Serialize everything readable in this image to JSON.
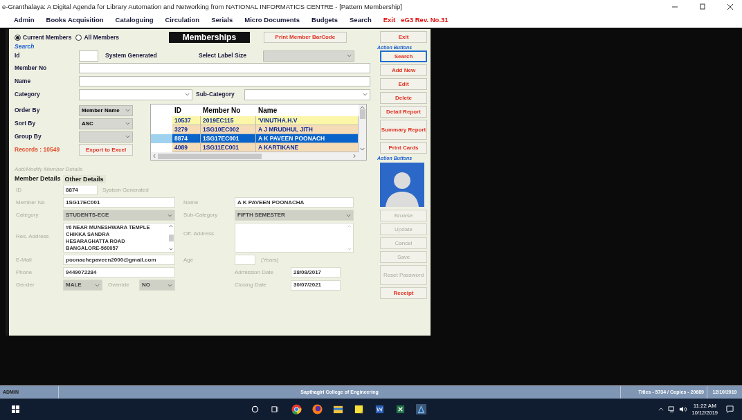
{
  "window": {
    "title": "e-Granthalaya: A Digital Agenda for Library Automation and Networking from NATIONAL INFORMATICS CENTRE - [Pattern Membership]"
  },
  "menu": [
    {
      "label": "Admin",
      "kind": "item"
    },
    {
      "label": "Books Acquisition",
      "kind": "item"
    },
    {
      "label": "Cataloguing",
      "kind": "item"
    },
    {
      "label": "Circulation",
      "kind": "item"
    },
    {
      "label": "Serials",
      "kind": "item"
    },
    {
      "label": "Micro Documents",
      "kind": "item"
    },
    {
      "label": "Budgets",
      "kind": "item"
    },
    {
      "label": "Search",
      "kind": "item"
    },
    {
      "label": "Exit",
      "kind": "exit"
    },
    {
      "label": "eG3 Rev. No.31",
      "kind": "version"
    }
  ],
  "form": {
    "filters": [
      {
        "label": "Current Members",
        "selected": true
      },
      {
        "label": "All Members",
        "selected": false
      }
    ],
    "heading": "Memberships",
    "print_barcode_button": "Print Member BarCode",
    "search": {
      "caption": "Search",
      "id_label": "Id",
      "id_note": "System Generated",
      "label_size_label": "Select Label Size",
      "member_no_label": "Member No",
      "name_label": "Name",
      "category_label": "Category",
      "subcategory_label": "Sub-Category",
      "order_by": {
        "label": "Order By",
        "value": "Member Name"
      },
      "sort_by": {
        "label": "Sort By",
        "value": "ASC"
      },
      "group_by": {
        "label": "Group By"
      },
      "records": "Records : 10549",
      "export_button": "Export to Excel"
    },
    "grid": {
      "columns": [
        "ID",
        "Member No",
        "Name"
      ],
      "rows": [
        {
          "cells": [
            "10537",
            "2019EC115",
            "'VINUTHA.H.V"
          ],
          "color": "#fbf6a8",
          "selected": false
        },
        {
          "cells": [
            "3279",
            "1SG10EC002",
            "A J MRUDHUL JITH"
          ],
          "color": "#f6dcb6",
          "selected": false
        },
        {
          "cells": [
            "8874",
            "1SG17EC001",
            "A K PAVEEN POONACH"
          ],
          "selected": true
        },
        {
          "cells": [
            "4089",
            "1SG11EC001",
            "A KARTIKANE"
          ],
          "color": "#f6dcb6",
          "selected": false
        }
      ]
    },
    "details": {
      "caption": "Add/Modify Member Details",
      "tabs": [
        {
          "label": "Member Details",
          "selected": true
        },
        {
          "label": "Other Details",
          "selected": false
        }
      ],
      "id": {
        "label": "ID",
        "value": "8874",
        "note": "System Generated"
      },
      "member_no": {
        "label": "Member No",
        "value": "1SG17EC001"
      },
      "name": {
        "label": "Name",
        "value": "A K PAVEEN POONACHA"
      },
      "category": {
        "label": "Category",
        "value": "STUDENTS-ECE"
      },
      "sub_category": {
        "label": "Sub-Category",
        "value": "FIFTH SEMESTER"
      },
      "res_address": {
        "label": "Res. Address",
        "lines": [
          "#6 NEAR MUNESHWARA TEMPLE",
          "CHIKKA SANDRA",
          "HESARAGHATTA ROAD",
          "BANGALORE-560057"
        ]
      },
      "off_address": {
        "label": "Off. Address"
      },
      "email": {
        "label": "E-Mail",
        "value": "poonachepaveen2000@gmail.com"
      },
      "age": {
        "label": "Age",
        "unit": "(Years)"
      },
      "phone": {
        "label": "Phone",
        "value": "9449072284"
      },
      "admission_date": {
        "label": "Admission Date",
        "value": "28/08/2017"
      },
      "gender": {
        "label": "Gender",
        "value": "MALE"
      },
      "override": {
        "label": "Override",
        "value": "NO"
      },
      "closing_date": {
        "label": "Closing Date",
        "value": "30/07/2021"
      }
    },
    "exit_button": "Exit",
    "action_caption_1": "Action Buttons",
    "action_buttons": [
      {
        "label": "Search",
        "focused": true,
        "disabled": false
      },
      {
        "label": "Add New",
        "focused": false,
        "disabled": false
      },
      {
        "label": "Edit",
        "focused": false,
        "disabled": false
      },
      {
        "label": "Delete",
        "focused": false,
        "disabled": false
      },
      {
        "label": "Detail Report",
        "focused": false,
        "disabled": false
      },
      {
        "label": "Summary Report",
        "focused": false,
        "disabled": false
      },
      {
        "label": "Print Cards",
        "focused": false,
        "disabled": false
      }
    ],
    "action_caption_2": "Action Buttons",
    "photo_buttons": [
      {
        "label": "Browse",
        "disabled": true
      },
      {
        "label": "Update",
        "disabled": true
      },
      {
        "label": "Cancel",
        "disabled": true
      },
      {
        "label": "Save",
        "disabled": true
      },
      {
        "label": "Reset Password",
        "disabled": true
      },
      {
        "label": "Receipt",
        "disabled": false
      }
    ]
  },
  "status_bar": {
    "user": "ADMIN",
    "college": "Sapthagiri College of Engineering",
    "counts": "Titles - 5734 / Copies - 20689",
    "date": "12/10/2019"
  },
  "taskbar": {
    "time": "11:22 AM",
    "date": "10/12/2019"
  }
}
